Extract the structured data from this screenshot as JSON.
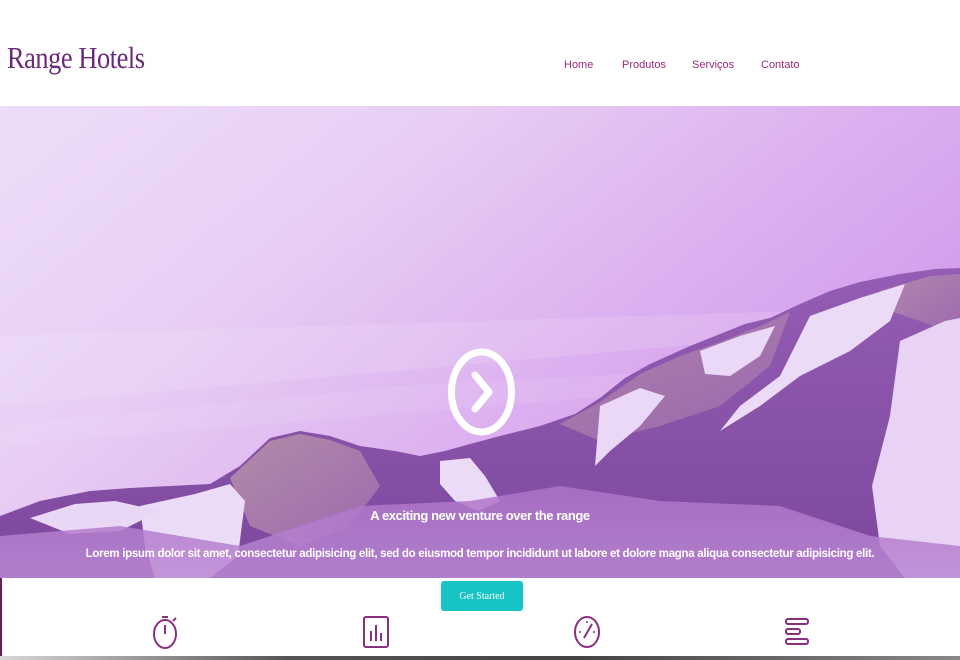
{
  "header": {
    "logo": "Range Hotels",
    "nav": [
      {
        "label": "Home"
      },
      {
        "label": "Produtos"
      },
      {
        "label": "Serviços"
      },
      {
        "label": "Contato"
      }
    ]
  },
  "hero": {
    "tagline": "A exciting new venture over the range",
    "description": "Lorem ipsum dolor sit amet, consectetur adipisicing elit, sed do eiusmod tempor incididunt ut labore et dolore magna aliqua consectetur adipisicing elit.",
    "play_icon": "chevron-right-circle-icon"
  },
  "cta": {
    "label": "Get Started"
  },
  "features": {
    "icons": [
      "stopwatch-icon",
      "bar-chart-icon",
      "speedometer-icon",
      "list-bars-icon"
    ]
  },
  "colors": {
    "brand": "#6a2a78",
    "nav": "#9b2a79",
    "accent": "#17c4c5",
    "hero_tint": "#c983e8"
  }
}
